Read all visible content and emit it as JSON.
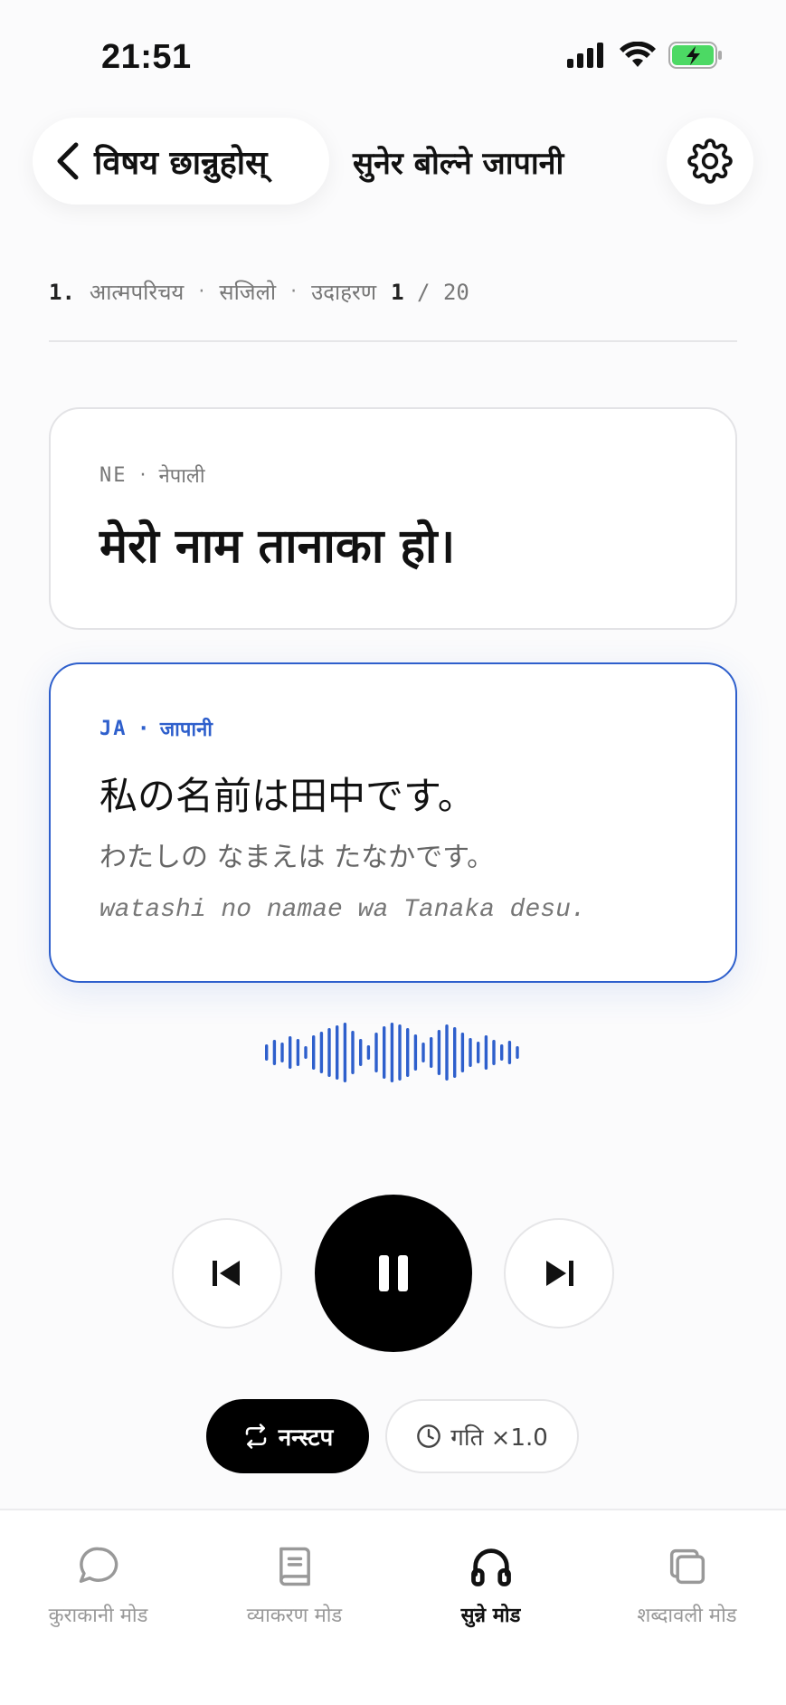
{
  "status_bar": {
    "time": "21:51"
  },
  "header": {
    "back_label": "विषय छान्नुहोस्",
    "title": "सुनेर बोल्ने जापानी"
  },
  "breadcrumb": {
    "lesson_number": "1.",
    "lesson_name": "आत्मपरिचय",
    "level": "सजिलो",
    "example_label": "उदाहरण",
    "current": "1",
    "separator": "/",
    "total": "20"
  },
  "source_card": {
    "lang_code": "NE",
    "lang_name": "नेपाली",
    "text": "मेरो नाम तानाका हो।"
  },
  "target_card": {
    "lang_code": "JA",
    "lang_name": "जापानी",
    "text": "私の名前は田中です。",
    "kana": "わたしの なまえは たなかです。",
    "romaji": "watashi no namae wa Tanaka desu."
  },
  "controls": {
    "loop_label": "नन्स्टप",
    "speed_label": "गति ×1.0"
  },
  "bottom_nav": [
    {
      "label": "कुराकानी मोड",
      "icon": "chat-bubble-icon",
      "active": false
    },
    {
      "label": "व्याकरण मोड",
      "icon": "book-icon",
      "active": false
    },
    {
      "label": "सुन्ने मोड",
      "icon": "headphones-icon",
      "active": true
    },
    {
      "label": "शब्दावली मोड",
      "icon": "cards-icon",
      "active": false
    }
  ],
  "colors": {
    "accent": "#2e5fcc",
    "primary": "#000000",
    "muted": "#999999"
  }
}
